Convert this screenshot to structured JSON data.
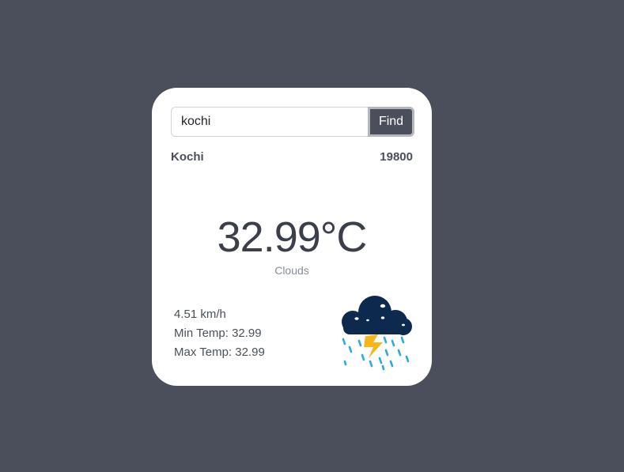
{
  "search": {
    "value": "kochi",
    "button_label": "Find"
  },
  "location": {
    "city": "Kochi",
    "timezone": "19800"
  },
  "weather": {
    "temperature": "32.99°C",
    "condition": "Clouds",
    "wind": "4.51 km/h",
    "min_temp": "Min Temp: 32.99",
    "max_temp": "Max Temp: 32.99",
    "icon": "thunderstorm-rain-cloud-icon"
  },
  "colors": {
    "background": "#4b4f5b",
    "card": "#ffffff",
    "cloud": "#0d2a4e",
    "rain": "#29abe2",
    "lightning": "#f7b51b"
  }
}
